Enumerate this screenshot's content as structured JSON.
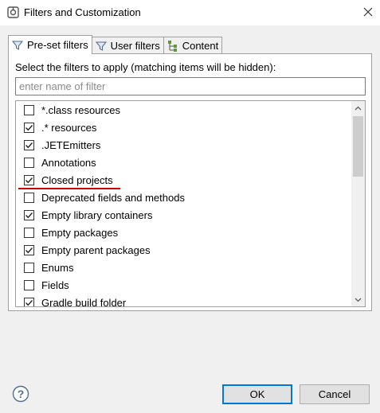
{
  "window": {
    "title": "Filters and Customization"
  },
  "tabs": [
    {
      "label": "Pre-set filters",
      "icon": "filter-icon",
      "active": true
    },
    {
      "label": "User filters",
      "icon": "filter-icon",
      "active": false
    },
    {
      "label": "Content",
      "icon": "content-tree-icon",
      "active": false
    }
  ],
  "panel": {
    "instruction": "Select the filters to apply (matching items will be hidden):",
    "filter_placeholder": "enter name of filter",
    "filter_value": ""
  },
  "filters": [
    {
      "label": "*.class resources",
      "checked": false
    },
    {
      "label": ".* resources",
      "checked": true
    },
    {
      "label": ".JETEmitters",
      "checked": true
    },
    {
      "label": "Annotations",
      "checked": false
    },
    {
      "label": "Closed projects",
      "checked": true,
      "highlighted": true
    },
    {
      "label": "Deprecated fields and methods",
      "checked": false
    },
    {
      "label": "Empty library containers",
      "checked": true
    },
    {
      "label": "Empty packages",
      "checked": false
    },
    {
      "label": "Empty parent packages",
      "checked": true
    },
    {
      "label": "Enums",
      "checked": false
    },
    {
      "label": "Fields",
      "checked": false
    },
    {
      "label": "Gradle build folder",
      "checked": true
    }
  ],
  "buttons": {
    "ok": "OK",
    "cancel": "Cancel"
  },
  "colors": {
    "highlight_underline": "#d00000",
    "default_button_border": "#0078d7"
  }
}
